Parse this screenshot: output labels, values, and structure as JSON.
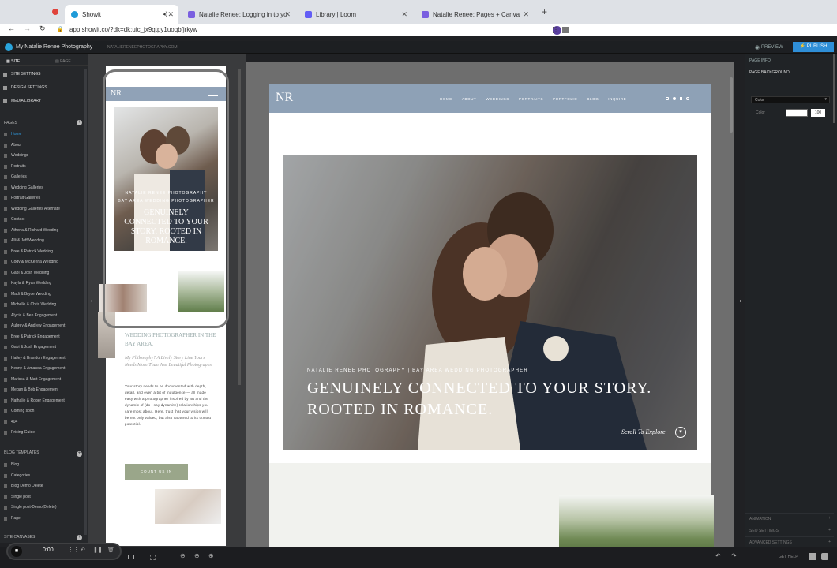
{
  "browser": {
    "tabs": [
      {
        "title": "Showit",
        "active": true
      },
      {
        "title": "Natalie Renee: Logging in to yo",
        "active": false
      },
      {
        "title": "Library | Loom",
        "active": false
      },
      {
        "title": "Natalie Renee: Pages + Canva",
        "active": false
      }
    ],
    "url": "app.showit.co/?dk=dk:uic_jx9qtpy1uoqbfjrkyw",
    "new_tab": "+"
  },
  "app": {
    "title": "My Natalie Renee Photography",
    "domain": "NATALIERENEEPHOTOGRAPHY.COM",
    "preview": "PREVIEW",
    "publish": "PUBLISH"
  },
  "sidebar": {
    "tabs": {
      "site": "SITE",
      "page": "PAGE"
    },
    "settings": [
      "SITE SETTINGS",
      "DESIGN SETTINGS",
      "MEDIA LIBRARY"
    ],
    "pages_header": "PAGES",
    "pages": [
      "Home",
      "About",
      "Weddings",
      "Portraits",
      "Galleries",
      "Wedding Galleries",
      "Portrait Galleries",
      "Wedding Galleries Alternate",
      "Contact",
      "Athena & Richard Wedding",
      "Alli & Jeff Wedding",
      "Bree & Patrick Wedding",
      "Cody & McKenna Wedding",
      "Gabi & Josh Wedding",
      "Kayla & Ryan Wedding",
      "Madi & Bryce Wedding",
      "Michelle & Chris Wedding",
      "Alycia & Ben Engagement",
      "Aubrey & Andrew Engagement",
      "Bree & Patrick Engagement",
      "Gabi & Josh Engagement",
      "Hailey & Brandon Engagement",
      "Kenny & Amanda Engagement",
      "Marissa & Matt Engagement",
      "Megan & Bob Engagement",
      "Nathalie & Roger Engagement",
      "Coming soon",
      "404",
      "Pricing Guide"
    ],
    "blog_header": "BLOG TEMPLATES",
    "blog": [
      "Blog",
      "Categories",
      "Blog Demo Delete",
      "Single post",
      "Single post-Demo(Delete)",
      "Page"
    ],
    "canvases_header": "SITE CANVASES"
  },
  "site": {
    "logo": "NR",
    "nav": [
      "HOME",
      "ABOUT",
      "WEDDINGS",
      "PORTRAITS",
      "PORTFOLIO",
      "BLOG",
      "INQUIRE"
    ],
    "subtitle": "NATALIE RENEE PHOTOGRAPHY | BAY AREA WEDDING PHOTOGRAPHER",
    "headline1": "GENUINELY CONNECTED TO YOUR STORY.",
    "headline2": "ROOTED IN ROMANCE.",
    "scroll": "Scroll To Explore"
  },
  "mobile": {
    "subtitle1": "NATALIE RENEE PHOTOGRAPHY",
    "subtitle2": "BAY AREA WEDDING PHOTOGRAPHER",
    "headline": "GENUINELY CONNECTED TO YOUR STORY, ROOTED IN ROMANCE.",
    "heading2": "WEDDING PHOTOGRAPHER IN THE BAY AREA.",
    "italic": "My Philosophy? A Lively Story Line Yours Needs More Than Just Beautiful Photographs.",
    "body": "Your story needs to be documented with depth, detail, and even a bit of indulgence — all made easy with a photographer inspired by art and the dynamic of (do I say dynamite) relationships you care most about. Here, trust that your vision will be not only valued, but also captured to its utmost potential.",
    "cta": "COUNT US IN"
  },
  "right": {
    "page_info": "PAGE INFO",
    "page_background": "PAGE BACKGROUND",
    "color_select": "Color",
    "color_label": "Color",
    "opacity": "100",
    "sections": [
      "ANIMATION",
      "SEO SETTINGS",
      "ADVANCED SETTINGS"
    ]
  },
  "bottom": {
    "time": "0:00",
    "help": "GET HELP"
  }
}
